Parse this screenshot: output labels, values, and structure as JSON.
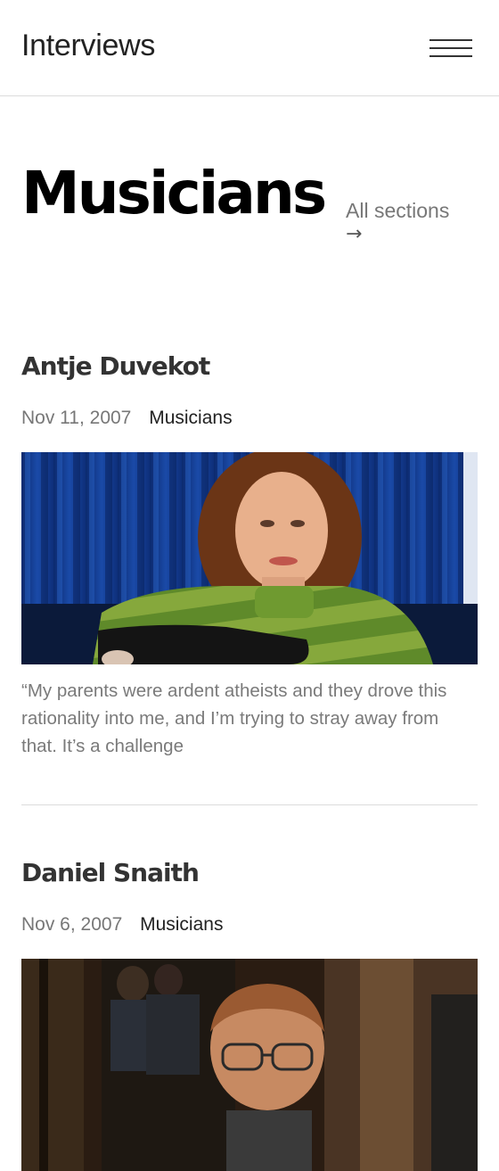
{
  "header": {
    "site_title": "Interviews",
    "menu_icon": "hamburger-menu-icon"
  },
  "section": {
    "title": "Musicians",
    "all_sections_label": "All sections",
    "arrow": "→"
  },
  "posts": [
    {
      "title": "Antje Duvekot",
      "date": "Nov 11, 2007",
      "category": "Musicians",
      "excerpt": "“My parents were ardent atheists and they drove this rationality into me, and I’m trying to stray away from that. It’s a challenge"
    },
    {
      "title": "Daniel Snaith",
      "date": "Nov 6, 2007",
      "category": "Musicians"
    }
  ],
  "colors": {
    "background": "#ffffff",
    "divider": "#dcdcdc",
    "muted_text": "#777777"
  }
}
